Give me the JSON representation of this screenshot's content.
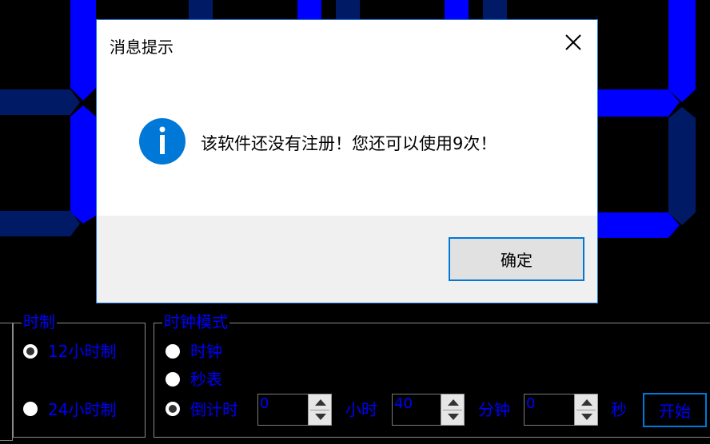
{
  "dialog": {
    "title": "消息提示",
    "message": "该软件还没有注册！您还可以使用9次！",
    "ok_label": "确定"
  },
  "hour_format_group": {
    "title": "时制",
    "options": [
      {
        "label": "12小时制",
        "selected": true
      },
      {
        "label": "24小时制",
        "selected": false
      }
    ]
  },
  "clock_mode_group": {
    "title": "时钟模式",
    "options": [
      {
        "label": "时钟",
        "selected": false
      },
      {
        "label": "秒表",
        "selected": false
      },
      {
        "label": "倒计时",
        "selected": true
      }
    ],
    "hours_value": "0",
    "hours_unit": "小时",
    "minutes_value": "40",
    "minutes_unit": "分钟",
    "seconds_value": "0",
    "seconds_unit": "秒",
    "start_label": "开始"
  },
  "colors": {
    "segment_on": "#0000ff",
    "segment_off": "#001a66",
    "label_text": "#0000ff",
    "dialog_border": "#1e73d2",
    "info_icon": "#0078d7"
  }
}
